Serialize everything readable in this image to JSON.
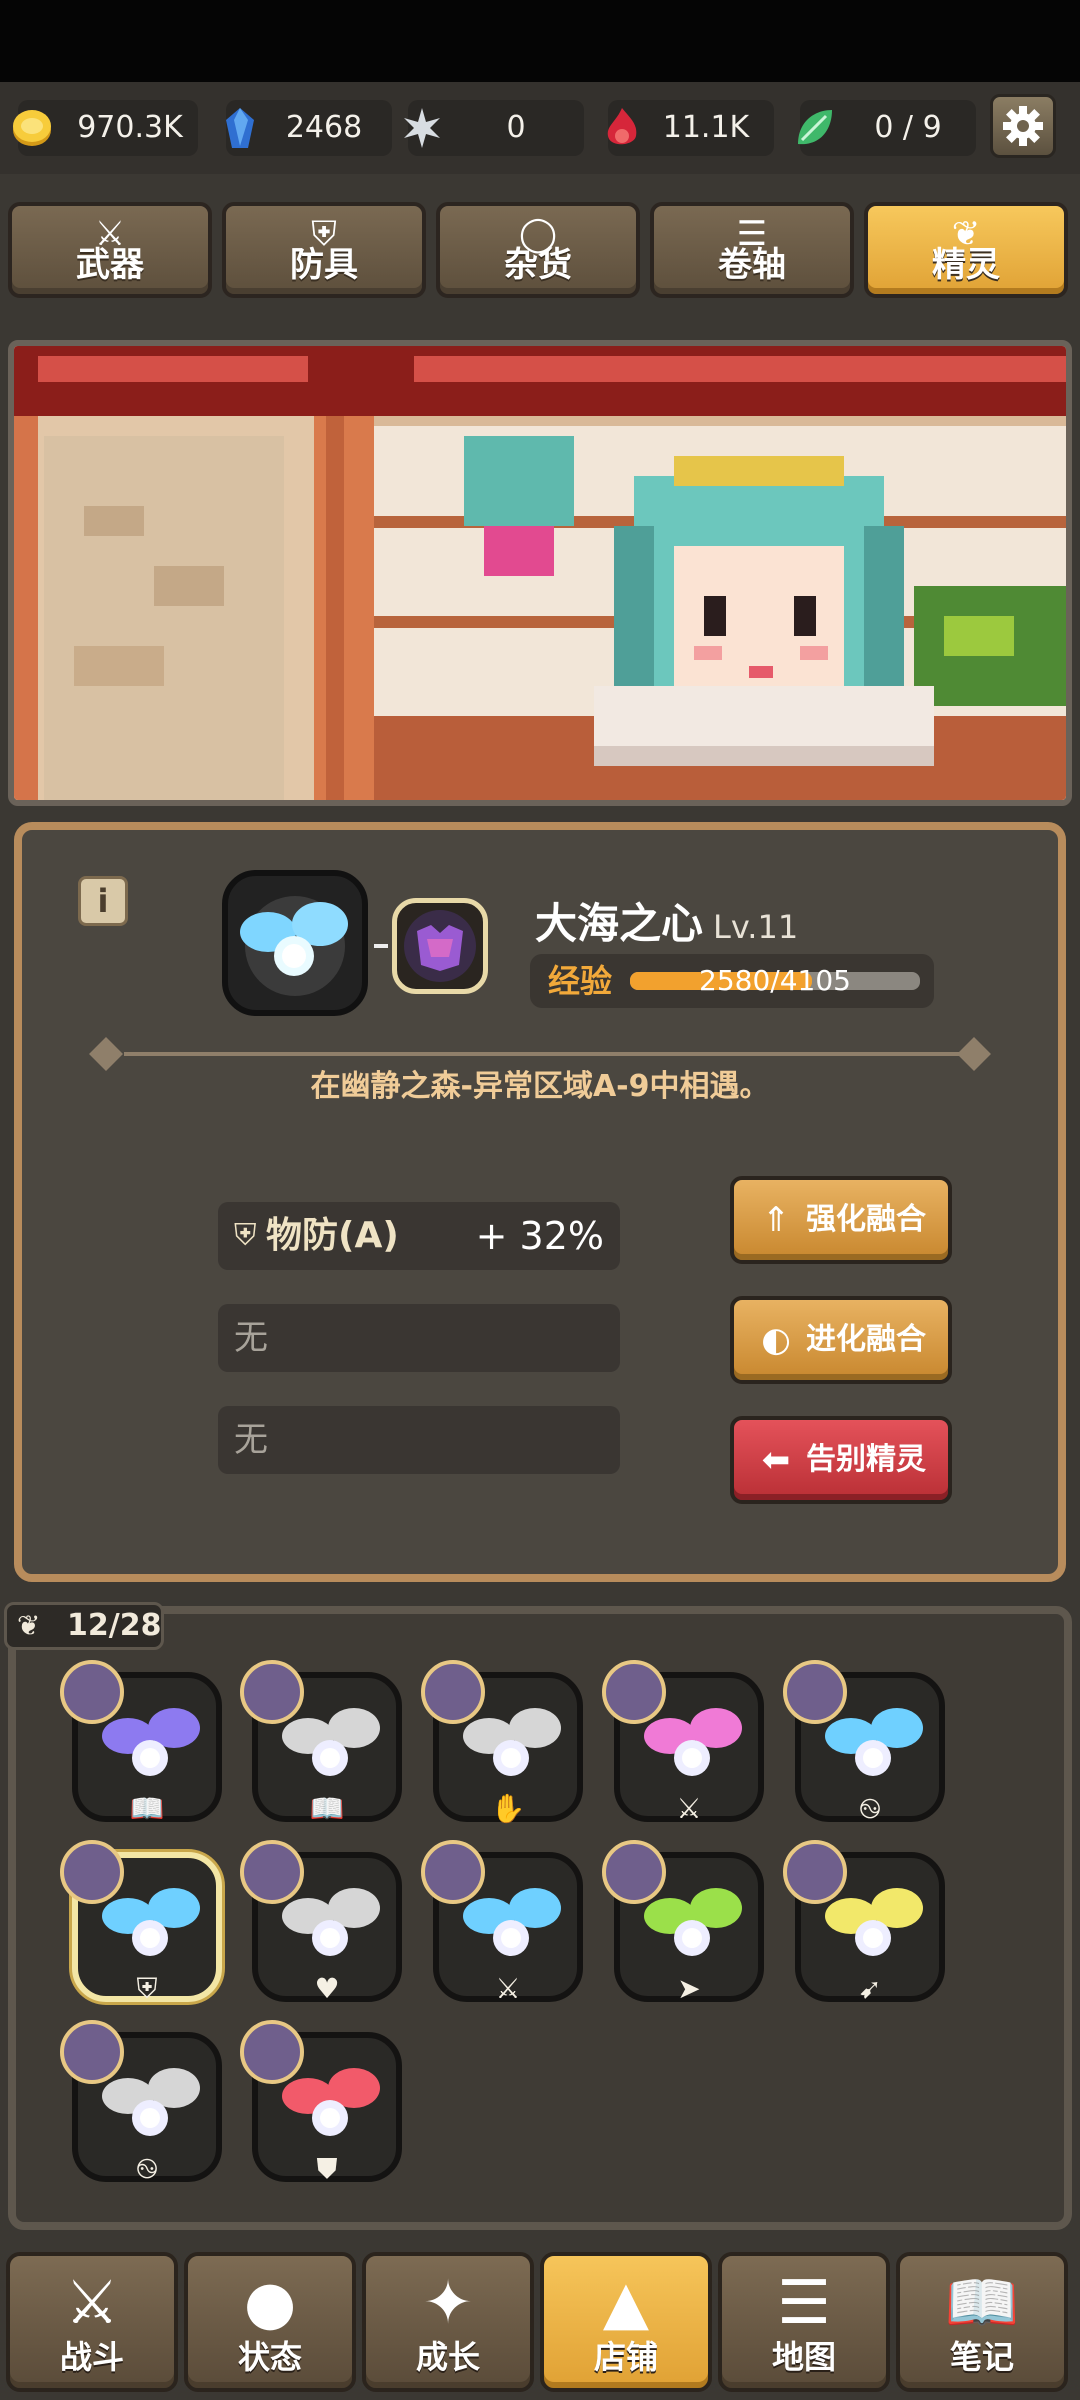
{
  "resources": [
    {
      "icon": "gold-coin-icon",
      "value": "970.3K"
    },
    {
      "icon": "blue-crystal-icon",
      "value": "2468"
    },
    {
      "icon": "silver-star-icon",
      "value": "0"
    },
    {
      "icon": "red-flame-icon",
      "value": "11.1K"
    },
    {
      "icon": "green-leaf-gem-icon",
      "value": "0 / 9"
    }
  ],
  "tabs": [
    {
      "label": "武器",
      "icon": "sword-icon"
    },
    {
      "label": "防具",
      "icon": "shield-icon"
    },
    {
      "label": "杂货",
      "icon": "ring-icon"
    },
    {
      "label": "卷轴",
      "icon": "scroll-icon"
    },
    {
      "label": "精灵",
      "icon": "fairy-wings-icon"
    }
  ],
  "fairy": {
    "name": "大海之心",
    "level": "Lv.11",
    "exp_label": "经验",
    "exp_text": "2580/4105",
    "exp_current": 2580,
    "exp_max": 4105,
    "location": "在幽静之森-异常区域A-9中相遇。",
    "stats": [
      {
        "label": "物防(A)",
        "value": "+ 32%",
        "icon": "shield-icon"
      },
      {
        "label": "无"
      },
      {
        "label": "无"
      }
    ],
    "actions": {
      "enhance": "强化融合",
      "evolve": "进化融合",
      "farewell": "告别精灵"
    }
  },
  "inventory": {
    "count": "12/28",
    "slots": [
      {
        "wing": "purple",
        "type_icon": "book-icon",
        "type": "📖"
      },
      {
        "wing": "silver",
        "type_icon": "book-icon",
        "type": "📖"
      },
      {
        "wing": "silver",
        "type_icon": "hand-icon",
        "type": "✋"
      },
      {
        "wing": "pink",
        "type_icon": "sword-target-icon",
        "type": "⚔"
      },
      {
        "wing": "blue",
        "type_icon": "swirl-icon",
        "type": "࿊"
      },
      {
        "wing": "blue",
        "type_icon": "shield-icon",
        "type": "⛨",
        "selected": true
      },
      {
        "wing": "silver",
        "type_icon": "heart-icon",
        "type": "♥"
      },
      {
        "wing": "blue",
        "type_icon": "sword-icon",
        "type": "⚔"
      },
      {
        "wing": "green",
        "type_icon": "boot-icon",
        "type": "➤"
      },
      {
        "wing": "yellow",
        "type_icon": "arrow-icon",
        "type": "➹"
      },
      {
        "wing": "silver",
        "type_icon": "swirl-icon",
        "type": "࿊"
      },
      {
        "wing": "red",
        "type_icon": "armor-icon",
        "type": "⛊"
      }
    ]
  },
  "bottom_nav": [
    {
      "label": "战斗",
      "icon": "crossed-swords-icon"
    },
    {
      "label": "状态",
      "icon": "person-icon"
    },
    {
      "label": "成长",
      "icon": "sparkle-icon"
    },
    {
      "label": "店铺",
      "icon": "tent-icon"
    },
    {
      "label": "地图",
      "icon": "signpost-icon"
    },
    {
      "label": "笔记",
      "icon": "book-icon"
    }
  ],
  "colors": {
    "accent_gold": "#f2a12e",
    "active_tab": "#f6c55a",
    "danger": "#d9434b",
    "panel_border": "#b88c5c"
  }
}
